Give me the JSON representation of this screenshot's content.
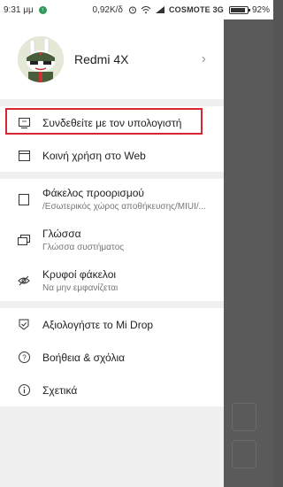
{
  "status": {
    "time": "9:31 μμ",
    "speed": "0,92K/δ",
    "carrier": "COSMOTE 3G",
    "battery": "92%"
  },
  "profile": {
    "device_name": "Redmi 4X"
  },
  "menu": {
    "connect_pc": "Συνδεθείτε με τον υπολογιστή",
    "web_share": "Κοινή χρήση στο Web",
    "dest_folder": {
      "label": "Φάκελος προορισμού",
      "sub": "/Εσωτερικός χώρος αποθήκευσης/MIUI/..."
    },
    "language": {
      "label": "Γλώσσα",
      "sub": "Γλώσσα συστήματος"
    },
    "hidden": {
      "label": "Κρυφοί φάκελοι",
      "sub": "Να μην εμφανίζεται"
    },
    "rate": "Αξιολογήστε το Mi Drop",
    "help": "Βοήθεια & σχόλια",
    "about": "Σχετικά"
  },
  "colors": {
    "highlight": "#d72631",
    "overlay": "#5a5a5a"
  }
}
